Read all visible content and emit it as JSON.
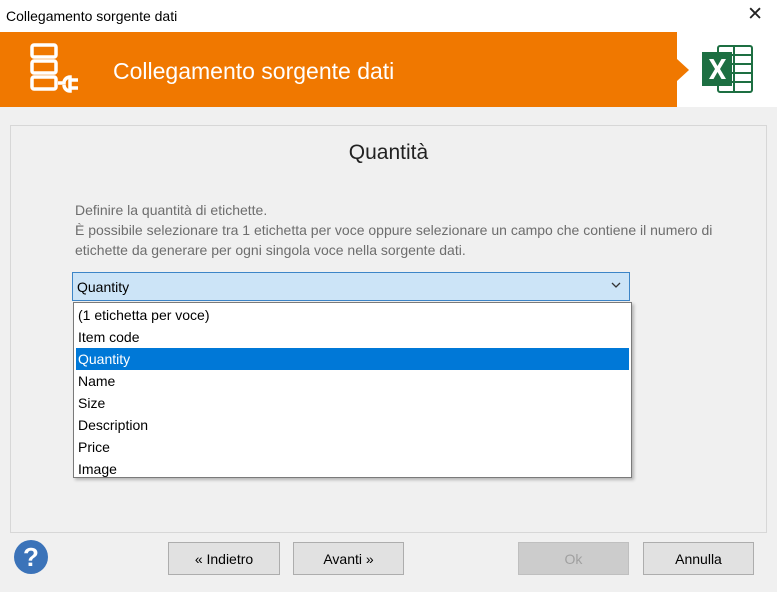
{
  "window": {
    "title": "Collegamento sorgente dati",
    "close_symbol": "✕"
  },
  "banner": {
    "heading": "Collegamento sorgente dati",
    "color": "#f07800"
  },
  "section": {
    "title": "Quantità",
    "description_lines": [
      "Definire la quantità di etichette.",
      "È possibile selezionare tra 1 etichetta per voce oppure selezionare un campo che contiene il numero di",
      "etichette da generare per ogni singola voce nella sorgente dati."
    ]
  },
  "combo": {
    "selected": "Quantity",
    "options": [
      "(1 etichetta per voce)",
      "Item code",
      "Quantity",
      "Name",
      "Size",
      "Description",
      "Price",
      "Image"
    ],
    "selected_index": 2
  },
  "buttons": {
    "back": "« Indietro",
    "next": "Avanti »",
    "ok": "Ok",
    "cancel": "Annulla"
  },
  "colors": {
    "accent": "#0078d7",
    "combo_bg": "#cce4f7",
    "help": "#3b73b9",
    "excel": "#1d6f42"
  },
  "icons": [
    "database-plug-icon",
    "excel-icon",
    "help-icon",
    "chevron-down-icon",
    "close-icon"
  ]
}
